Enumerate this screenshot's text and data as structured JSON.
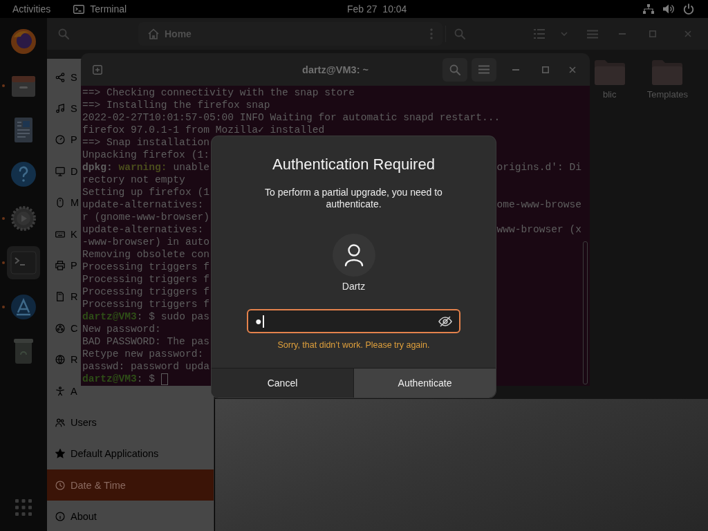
{
  "top_bar": {
    "activities": "Activities",
    "app_menu": "Terminal",
    "clock": "Feb 27  10:04"
  },
  "dock": {
    "items": [
      {
        "running": false,
        "focused": false
      },
      {
        "running": true,
        "focused": false
      },
      {
        "running": false,
        "focused": false
      },
      {
        "running": false,
        "focused": false
      },
      {
        "running": true,
        "focused": false
      },
      {
        "running": true,
        "focused": true
      },
      {
        "running": true,
        "focused": false
      },
      {
        "running": false,
        "focused": false
      }
    ]
  },
  "files_window": {
    "location": "Home",
    "folders": [
      {
        "label": "blic"
      },
      {
        "label": "Templates"
      }
    ]
  },
  "settings_window": {
    "sidebar": [
      {
        "label": "S",
        "selected": false
      },
      {
        "label": "S",
        "selected": false
      },
      {
        "label": "P",
        "selected": false
      },
      {
        "label": "D",
        "selected": false
      },
      {
        "label": "M",
        "selected": false
      },
      {
        "label": "K",
        "selected": false
      },
      {
        "label": "P",
        "selected": false
      },
      {
        "label": "R",
        "selected": false
      },
      {
        "label": "C",
        "selected": false
      },
      {
        "label": "R",
        "selected": false
      },
      {
        "label": "A",
        "selected": false
      },
      {
        "label": "Users",
        "selected": false
      },
      {
        "label": "Default Applications",
        "selected": false
      },
      {
        "label": "Date & Time",
        "selected": true
      },
      {
        "label": "About",
        "selected": false
      }
    ]
  },
  "terminal": {
    "title": "dartz@VM3: ~",
    "cursor": true,
    "lines": [
      {
        "segments": [
          {
            "kind": "plain",
            "text": "==> Checking connectivity with the snap store"
          }
        ]
      },
      {
        "segments": [
          {
            "kind": "plain",
            "text": "==> Installing the firefox snap"
          }
        ]
      },
      {
        "segments": [
          {
            "kind": "plain",
            "text": "2022-02-27T10:01:57-05:00 INFO Waiting for automatic snapd restart..."
          }
        ]
      },
      {
        "segments": [
          {
            "kind": "plain",
            "text": "firefox 97.0.1-1 from Mozilla✓ installed"
          }
        ]
      },
      {
        "segments": [
          {
            "kind": "plain",
            "text": "==> Snap installation"
          }
        ]
      },
      {
        "segments": [
          {
            "kind": "plain",
            "text": "Unpacking firefox (1:"
          }
        ]
      },
      {
        "segments": [
          {
            "kind": "bold",
            "text": "dpkg:"
          },
          {
            "kind": "warning",
            "text": " warning:"
          },
          {
            "kind": "plain",
            "text": " unable"
          }
        ],
        "tail": "origins.d': Di"
      },
      {
        "segments": [
          {
            "kind": "plain",
            "text": "rectory not empty"
          }
        ]
      },
      {
        "segments": [
          {
            "kind": "plain",
            "text": "Setting up firefox (1"
          }
        ]
      },
      {
        "segments": [
          {
            "kind": "plain",
            "text": "update-alternatives:"
          }
        ],
        "tail": "ome-www-browse"
      },
      {
        "segments": [
          {
            "kind": "plain",
            "text": "r (gnome-www-browser)"
          }
        ]
      },
      {
        "segments": [
          {
            "kind": "plain",
            "text": "update-alternatives:"
          }
        ],
        "tail": "www-browser (x"
      },
      {
        "segments": [
          {
            "kind": "plain",
            "text": "-www-browser) in auto"
          }
        ]
      },
      {
        "segments": [
          {
            "kind": "plain",
            "text": "Removing obsolete con"
          }
        ]
      },
      {
        "segments": [
          {
            "kind": "plain",
            "text": "Processing triggers f"
          }
        ]
      },
      {
        "segments": [
          {
            "kind": "plain",
            "text": "Processing triggers f"
          }
        ]
      },
      {
        "segments": [
          {
            "kind": "plain",
            "text": "Processing triggers f"
          }
        ]
      },
      {
        "segments": [
          {
            "kind": "plain",
            "text": "Processing triggers f"
          }
        ]
      },
      {
        "segments": [
          {
            "kind": "prompt",
            "text": "dartz@VM3"
          },
          {
            "kind": "plain",
            "text": ": $ sudo pas"
          }
        ]
      },
      {
        "segments": [
          {
            "kind": "plain",
            "text": "New password:"
          }
        ]
      },
      {
        "segments": [
          {
            "kind": "plain",
            "text": "BAD PASSWORD: The pas"
          }
        ]
      },
      {
        "segments": [
          {
            "kind": "plain",
            "text": "Retype new password:"
          }
        ]
      },
      {
        "segments": [
          {
            "kind": "plain",
            "text": "passwd: password upda"
          }
        ]
      },
      {
        "segments": [
          {
            "kind": "prompt",
            "text": "dartz@VM3"
          },
          {
            "kind": "plain",
            "text": ": $ "
          }
        ]
      }
    ]
  },
  "auth_dialog": {
    "title": "Authentication Required",
    "message": "To perform a partial upgrade, you need to authenticate.",
    "user": "Dartz",
    "password_field": {
      "value": "●",
      "focused": true
    },
    "error": "Sorry, that didn’t work. Please try again.",
    "buttons": [
      {
        "label": "Cancel",
        "highlighted": false
      },
      {
        "label": "Authenticate",
        "highlighted": true
      }
    ]
  }
}
